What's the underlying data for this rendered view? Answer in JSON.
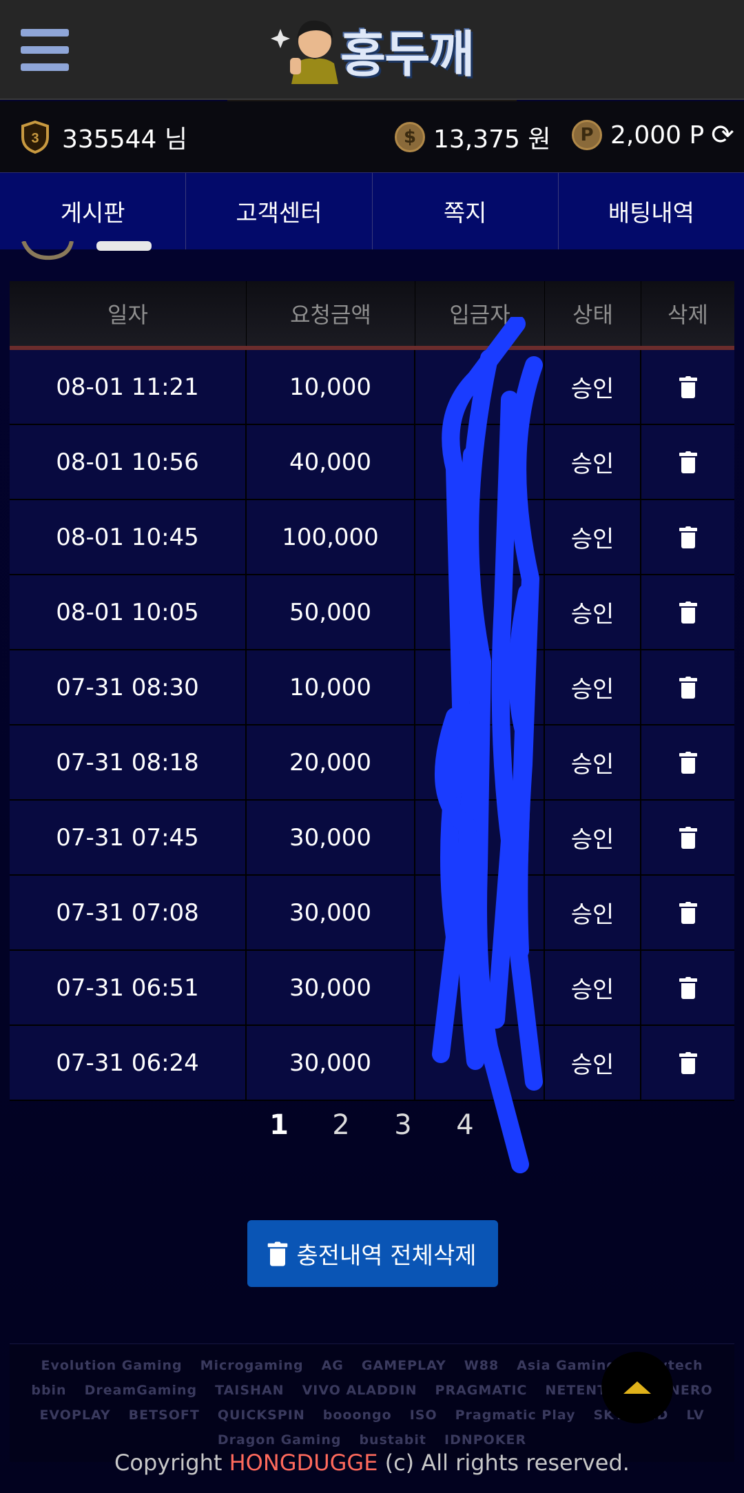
{
  "header": {
    "logo_text": "홍두깨"
  },
  "user": {
    "level": "3",
    "name": "335544 님",
    "money_label": "13,375 원",
    "point_label": "2,000 P"
  },
  "nav": [
    "게시판",
    "고객센터",
    "쪽지",
    "배팅내역"
  ],
  "table": {
    "headers": [
      "일자",
      "요청금액",
      "입금자",
      "상태",
      "삭제"
    ],
    "rows": [
      {
        "date": "08-01 11:21",
        "amount": "10,000",
        "status": "승인"
      },
      {
        "date": "08-01 10:56",
        "amount": "40,000",
        "status": "승인"
      },
      {
        "date": "08-01 10:45",
        "amount": "100,000",
        "status": "승인"
      },
      {
        "date": "08-01 10:05",
        "amount": "50,000",
        "status": "승인"
      },
      {
        "date": "07-31 08:30",
        "amount": "10,000",
        "status": "승인"
      },
      {
        "date": "07-31 08:18",
        "amount": "20,000",
        "status": "승인"
      },
      {
        "date": "07-31 07:45",
        "amount": "30,000",
        "status": "승인"
      },
      {
        "date": "07-31 07:08",
        "amount": "30,000",
        "status": "승인"
      },
      {
        "date": "07-31 06:51",
        "amount": "30,000",
        "status": "승인"
      },
      {
        "date": "07-31 06:24",
        "amount": "30,000",
        "status": "승인"
      }
    ]
  },
  "pagination": [
    "1",
    "2",
    "3",
    "4"
  ],
  "delete_all_label": "충전내역 전체삭제",
  "providers": [
    "Evolution Gaming",
    "Microgaming",
    "AG",
    "GAMEPLAY",
    "W88",
    "Asia Gaming",
    "playtech",
    "bbin",
    "DreamGaming",
    "TAISHAN",
    "VIVO ALADDIN",
    "PRAGMATIC",
    "NETENT",
    "HABANERO",
    "EVOPLAY",
    "BETSOFT",
    "QUICKSPIN",
    "booongo",
    "ISO",
    "Pragmatic Play",
    "SKYWIND",
    "LV",
    "Dragon Gaming",
    "bustabit",
    "IDNPOKER"
  ],
  "copyright": {
    "prefix": "Copyright ",
    "brand": "HONGDUGGE",
    "suffix": " (c) All rights reserved."
  },
  "colors": {
    "nav_bg": "#030a6a",
    "row_bg": "#080a40",
    "button_bg": "#0a55b5",
    "scribble": "#1a3cff",
    "brand_red": "#ff6a5c",
    "top_arrow": "#e0b21a"
  }
}
